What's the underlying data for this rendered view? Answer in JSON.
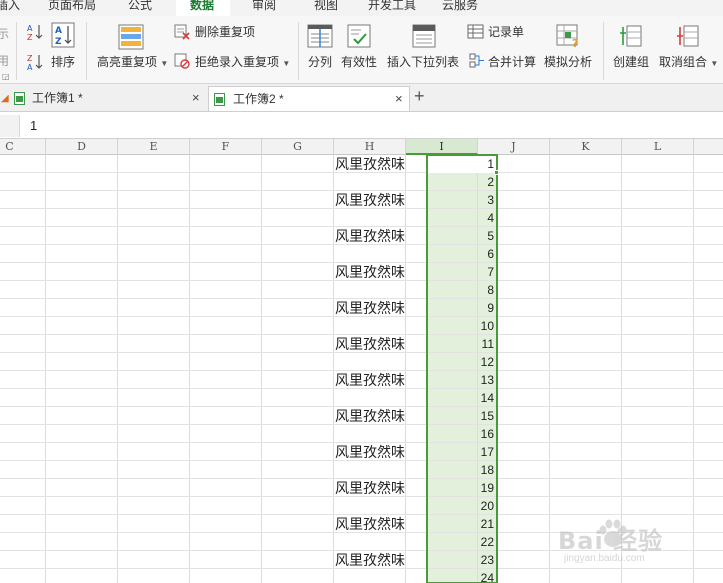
{
  "menu": {
    "tabs": [
      {
        "label": "插入"
      },
      {
        "label": "页面布局"
      },
      {
        "label": "公式"
      },
      {
        "label": "数据"
      },
      {
        "label": "审阅"
      },
      {
        "label": "视图"
      },
      {
        "label": "开发工具"
      },
      {
        "label": "云服务"
      }
    ]
  },
  "ribbon": {
    "partial_show": "示",
    "partial_apply": "用",
    "sort": "排序",
    "highlight_dupes": "高亮重复项",
    "remove_dupes": "删除重复项",
    "reject_dupes": "拒绝录入重复项",
    "split": "分列",
    "validity": "有效性",
    "insert_dropdown": "插入下拉列表",
    "record_form": "记录单",
    "consolidate": "合并计算",
    "what_if": "模拟分析",
    "group": "创建组",
    "ungroup": "取消组合"
  },
  "doc_tabs": [
    {
      "label": "工作簿1 *",
      "active": false
    },
    {
      "label": "工作簿2 *",
      "active": true
    }
  ],
  "formula_bar": {
    "value": "1"
  },
  "grid": {
    "columns": [
      "C",
      "D",
      "E",
      "F",
      "G",
      "H",
      "I",
      "J",
      "K",
      "L"
    ],
    "selected_column": "I",
    "column_h_text": "风里孜然味",
    "column_i_values": [
      "1",
      "2",
      "3",
      "4",
      "5",
      "6",
      "7",
      "8",
      "9",
      "10",
      "11",
      "12",
      "13",
      "14",
      "15",
      "16",
      "17",
      "18",
      "19",
      "20",
      "21",
      "22",
      "23",
      "24"
    ]
  },
  "watermark": {
    "text": "Bai 经验",
    "sub": "jingyan.baidu.com"
  },
  "colors": {
    "selection_green": "#4a9a3a",
    "selection_fill": "#e3f1dc",
    "active_tab": "#1b7b2f"
  }
}
